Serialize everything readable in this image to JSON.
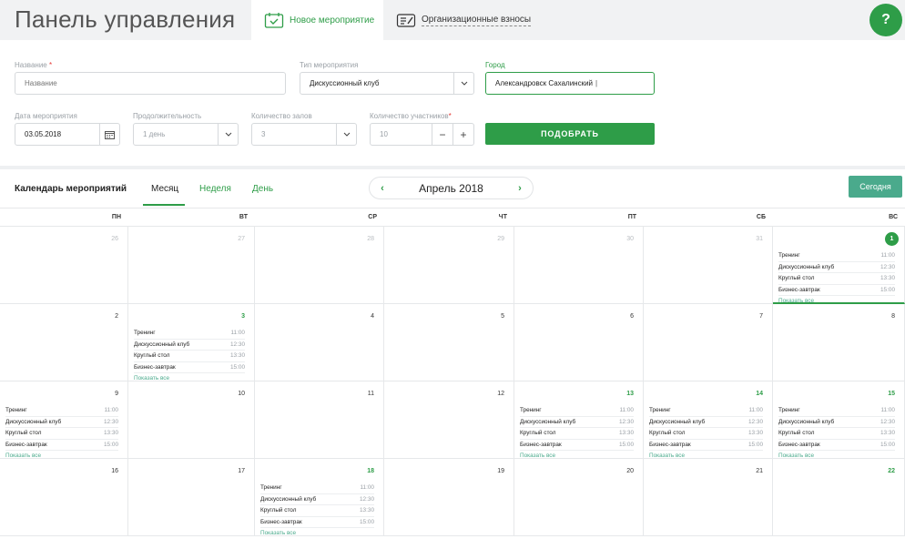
{
  "header": {
    "title": "Панель управления",
    "tabs": [
      {
        "label": "Новое мероприятие",
        "icon": "calendar-check-icon",
        "active": true
      },
      {
        "label": "Организационные взносы",
        "icon": "edit-list-icon",
        "active": false
      }
    ],
    "help_label": "?"
  },
  "form": {
    "name": {
      "label": "Название",
      "placeholder": "Название"
    },
    "type": {
      "label": "Тип мероприятия",
      "value": "Дискуссионный клуб"
    },
    "city": {
      "label": "Город",
      "value": "Александровск Сахалинский"
    },
    "date": {
      "label": "Дата мероприятия",
      "value": "03.05.2018"
    },
    "duration": {
      "label": "Продолжительность",
      "value": "1 день"
    },
    "halls": {
      "label": "Количество залов",
      "value": "3"
    },
    "participants": {
      "label": "Количество участников",
      "value": "10"
    },
    "submit_label": "ПОДОБРАТЬ"
  },
  "calendar": {
    "title": "Календарь мероприятий",
    "views": [
      "Месяц",
      "Неделя",
      "День"
    ],
    "month_label": "Апрель 2018",
    "today_label": "Сегодня",
    "weekdays": [
      "ПН",
      "ВТ",
      "СР",
      "ЧТ",
      "ПТ",
      "СБ",
      "ВС"
    ],
    "show_all_label": "Показать все",
    "weeks": [
      [
        {
          "day": "26",
          "muted": true
        },
        {
          "day": "27",
          "muted": true
        },
        {
          "day": "28",
          "muted": true
        },
        {
          "day": "29",
          "muted": true
        },
        {
          "day": "30",
          "muted": true
        },
        {
          "day": "31",
          "muted": true
        },
        {
          "day": "1",
          "today": true,
          "events": true
        }
      ],
      [
        {
          "day": "2"
        },
        {
          "day": "3",
          "events": true
        },
        {
          "day": "4"
        },
        {
          "day": "5"
        },
        {
          "day": "6"
        },
        {
          "day": "7"
        },
        {
          "day": "8"
        }
      ],
      [
        {
          "day": "9",
          "events": true,
          "plain": true
        },
        {
          "day": "10"
        },
        {
          "day": "11"
        },
        {
          "day": "12"
        },
        {
          "day": "13",
          "events": true
        },
        {
          "day": "14",
          "events": true
        },
        {
          "day": "15",
          "events": true
        }
      ],
      [
        {
          "day": "16"
        },
        {
          "day": "17"
        },
        {
          "day": "18",
          "events": true
        },
        {
          "day": "19"
        },
        {
          "day": "20"
        },
        {
          "day": "21"
        },
        {
          "day": "22",
          "highlight": true
        }
      ]
    ],
    "events": [
      {
        "name": "Тренинг",
        "time": "11:00"
      },
      {
        "name": "Дискуссионный клуб",
        "time": "12:30"
      },
      {
        "name": "Круглый стол",
        "time": "13:30"
      },
      {
        "name": "Бизнес-завтрак",
        "time": "15:00"
      }
    ]
  },
  "colors": {
    "accent": "#2e9d48",
    "teal": "#4aaa8c"
  }
}
